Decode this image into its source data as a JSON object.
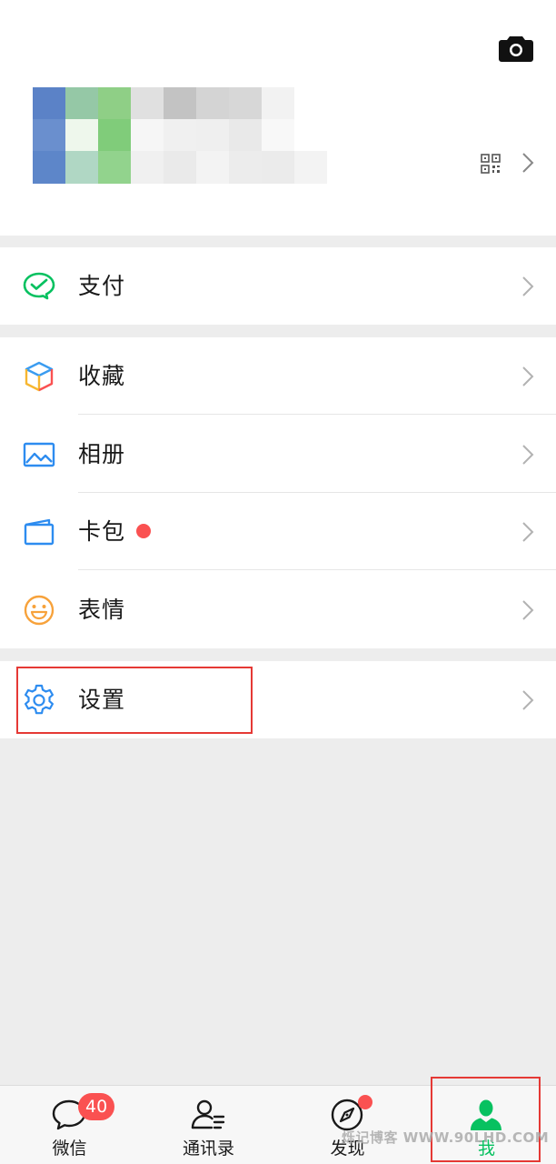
{
  "profile": {
    "camera_icon": "camera-icon",
    "avatar": "blurred-mosaic-avatar",
    "qr_icon": "qr-code-icon",
    "chevron_icon": "chevron-right-icon"
  },
  "menu": {
    "pay": {
      "label": "支付",
      "icon": "wechat-pay-icon"
    },
    "favorites": {
      "label": "收藏",
      "icon": "cube-icon"
    },
    "album": {
      "label": "相册",
      "icon": "image-icon"
    },
    "cards": {
      "label": "卡包",
      "icon": "card-wallet-icon",
      "has_new": true
    },
    "stickers": {
      "label": "表情",
      "icon": "smile-icon"
    },
    "settings": {
      "label": "设置",
      "icon": "gear-icon"
    }
  },
  "tabbar": {
    "tabs": [
      {
        "label": "微信",
        "icon": "chat-bubble-icon",
        "badge": "40"
      },
      {
        "label": "通讯录",
        "icon": "contacts-icon"
      },
      {
        "label": "发现",
        "icon": "compass-icon",
        "has_dot": true
      },
      {
        "label": "我",
        "icon": "person-icon",
        "active": true
      }
    ]
  },
  "watermark": "烁记博客 WWW.90LHD.COM",
  "colors": {
    "accent_green": "#07c160",
    "badge_red": "#fa5151",
    "highlight_red": "#e53935",
    "background": "#ededed"
  }
}
